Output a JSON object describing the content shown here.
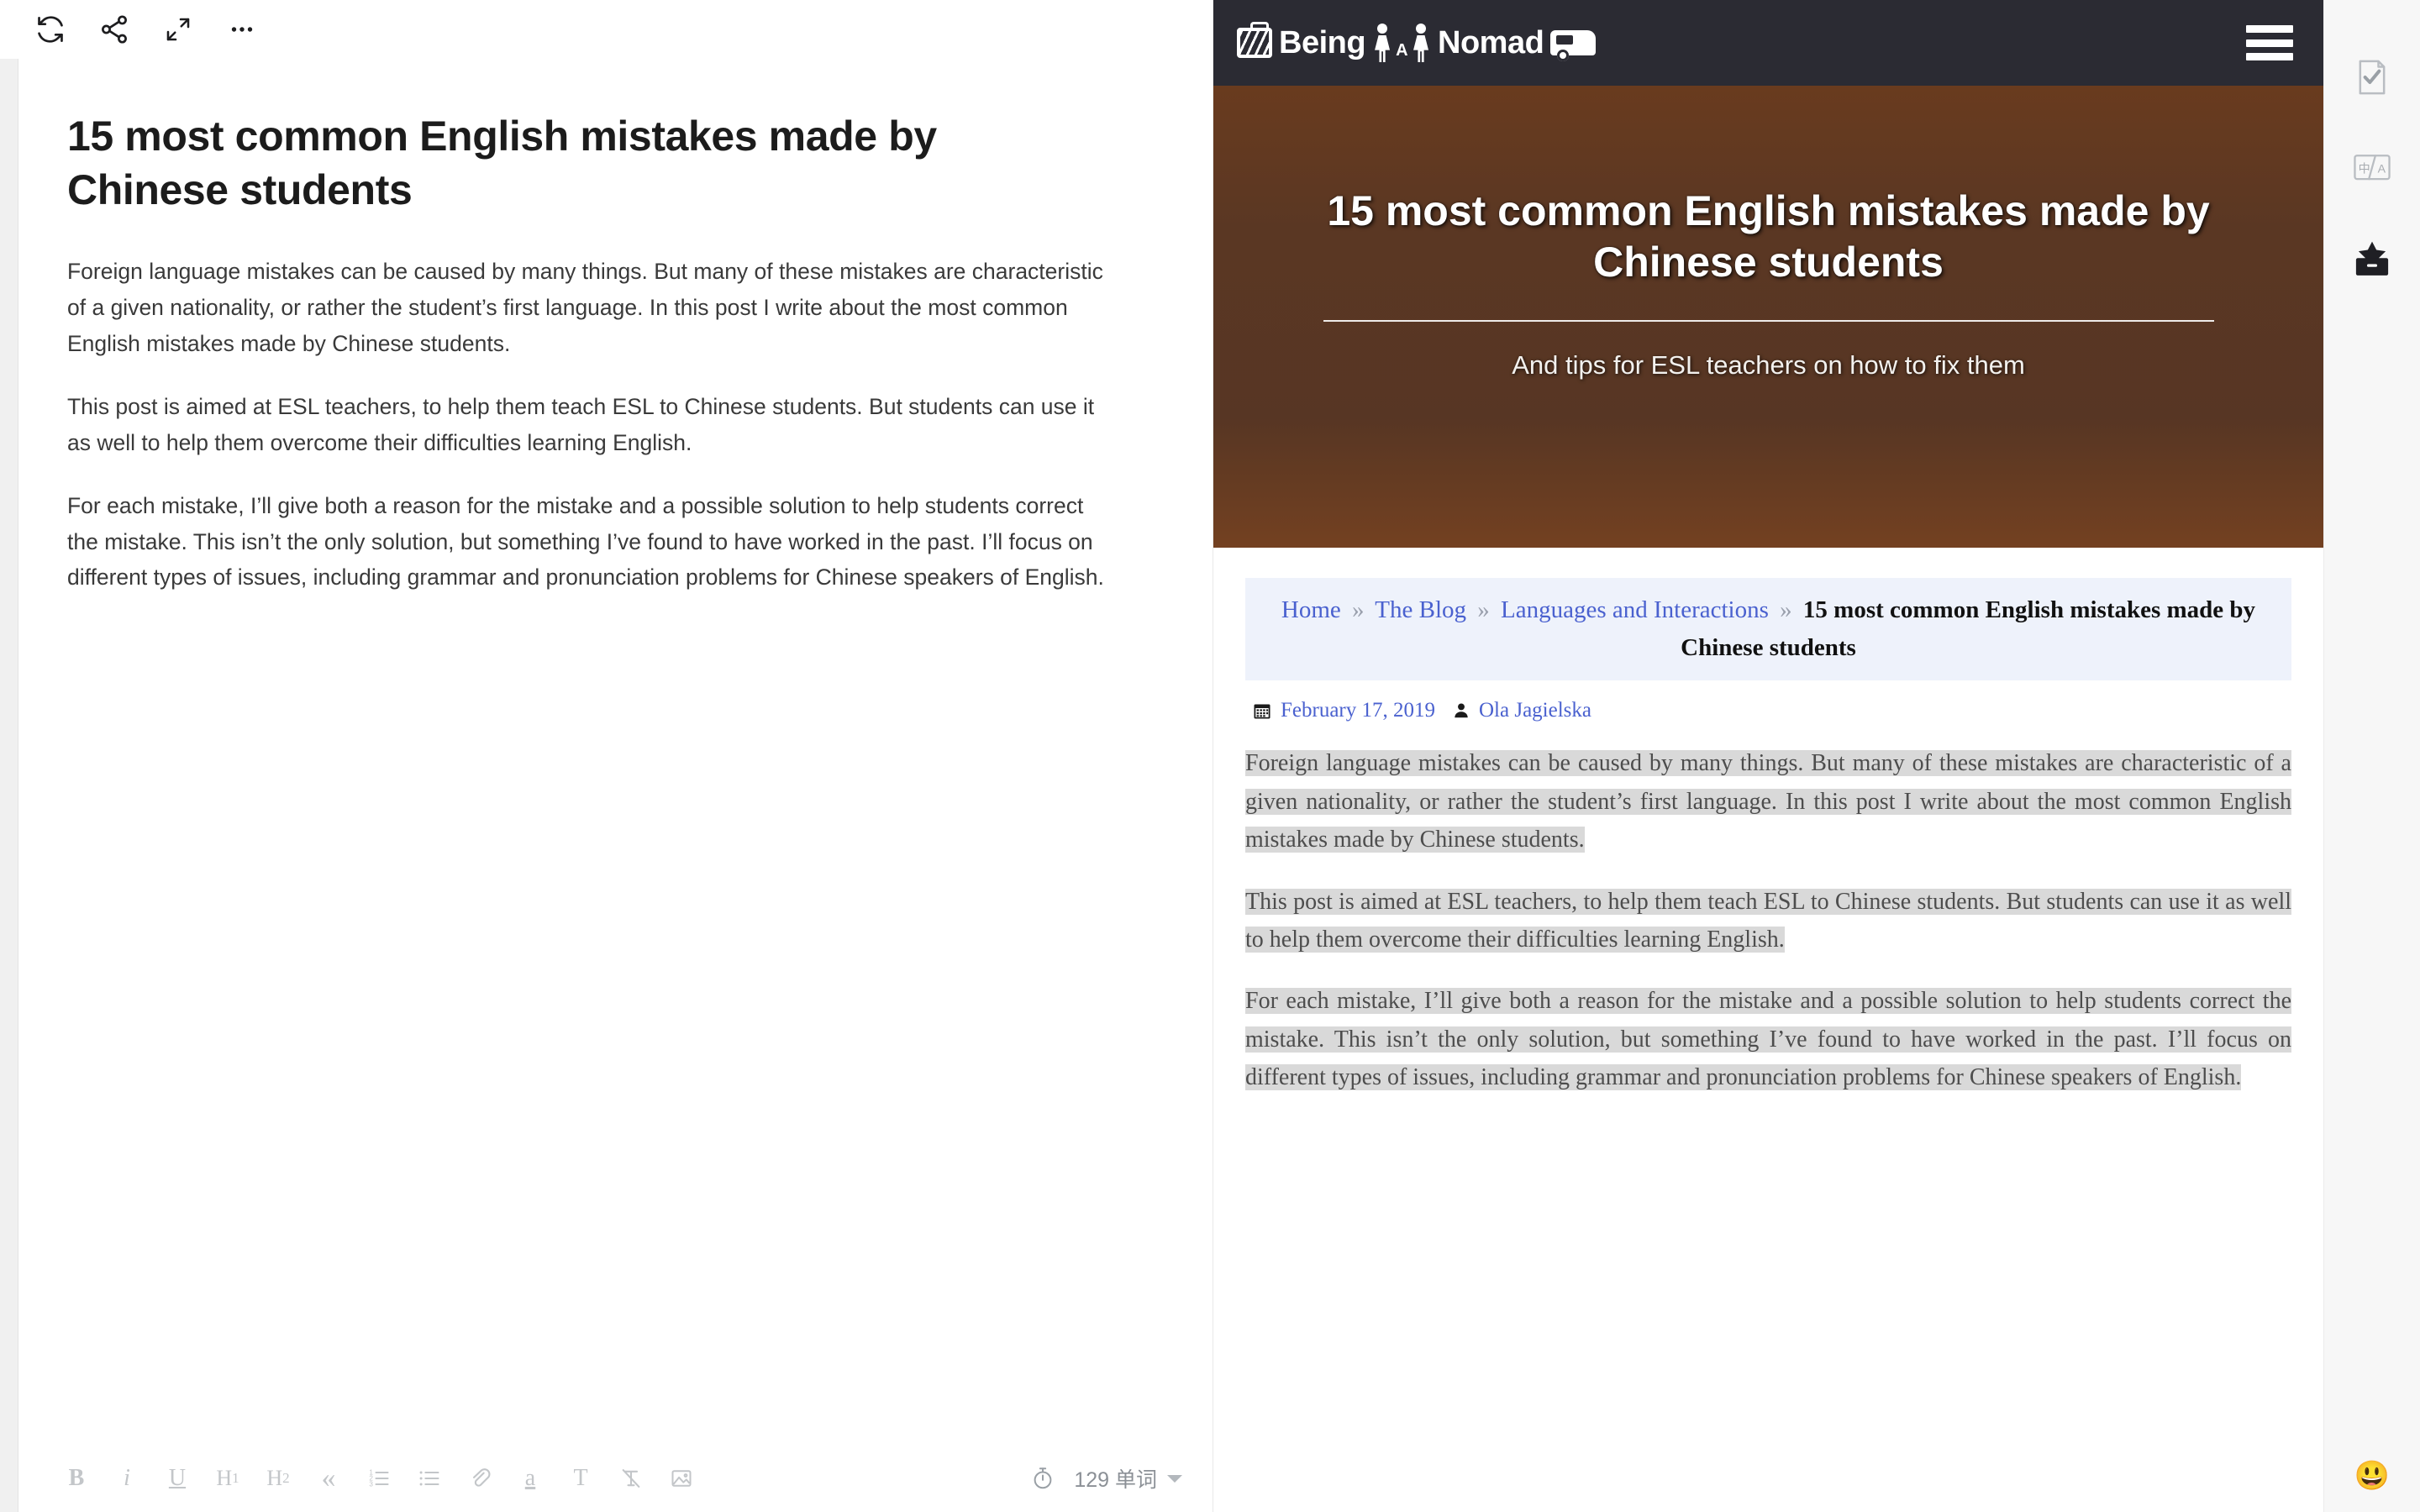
{
  "editor": {
    "toolbar_top": [
      {
        "name": "sync-icon",
        "label": "Sync"
      },
      {
        "name": "share-icon",
        "label": "Share"
      },
      {
        "name": "fullscreen-icon",
        "label": "Fullscreen"
      },
      {
        "name": "more-icon",
        "label": "More"
      }
    ],
    "document": {
      "title": "15 most common English mistakes made by Chinese students",
      "paragraphs": [
        "Foreign language mistakes can be caused by many things. But many of these mistakes are characteristic of a given nationality, or rather the student’s first language. In this post I write about the most common English mistakes made by Chinese students.",
        "This post is aimed at ESL teachers, to help them teach ESL to Chinese students. But students can use it as well to help them overcome their difficulties learning English.",
        "For each mistake, I’ll give both a reason for the mistake and a possible solution to help students correct the mistake. This isn’t the only solution, but something I’ve found to have worked in the past. I’ll focus on different types of issues, including grammar and pronunciation problems for Chinese speakers of English."
      ]
    },
    "format_toolbar": [
      {
        "name": "bold-button",
        "label": "B"
      },
      {
        "name": "italic-button",
        "label": "i"
      },
      {
        "name": "underline-button",
        "label": "U"
      },
      {
        "name": "heading1-button",
        "label": "H1"
      },
      {
        "name": "heading2-button",
        "label": "H2"
      },
      {
        "name": "blockquote-button",
        "label": "«"
      },
      {
        "name": "ordered-list-button",
        "label": "ordered-list-icon"
      },
      {
        "name": "unordered-list-button",
        "label": "unordered-list-icon"
      },
      {
        "name": "link-button",
        "label": "link-icon"
      },
      {
        "name": "text-color-button",
        "label": "a"
      },
      {
        "name": "font-button",
        "label": "T"
      },
      {
        "name": "clear-format-button",
        "label": "clear-format-icon"
      },
      {
        "name": "insert-image-button",
        "label": "image-icon"
      }
    ],
    "status": {
      "word_count": "129 单词",
      "timer_icon": "stopwatch-icon"
    }
  },
  "preview": {
    "site": {
      "logo_text_1": "Being",
      "logo_text_a": "A",
      "logo_text_2": "Nomad",
      "menu_label": "Menu"
    },
    "hero": {
      "title": "15 most common English mistakes made by Chinese students",
      "subtitle": "And tips for ESL teachers on how to fix them"
    },
    "breadcrumb": {
      "items": [
        {
          "label": "Home",
          "link": true
        },
        {
          "label": "The Blog",
          "link": true
        },
        {
          "label": "Languages and Interactions",
          "link": true
        }
      ],
      "separator": "»",
      "current": "15 most common English mistakes made by Chinese students"
    },
    "meta": {
      "date": "February 17, 2019",
      "author": "Ola Jagielska",
      "date_icon": "calendar-icon",
      "author_icon": "user-icon"
    },
    "post_paragraphs": [
      "Foreign language mistakes can be caused by many things. But many of these mistakes are characteristic of a given nationality, or rather the student’s first language. In this post I write about the most common English mistakes made by Chinese students.",
      "This post is aimed at ESL teachers, to help them teach ESL to Chinese students. But students can use it as well to help them overcome their difficulties learning English.",
      "For each mistake, I’ll give both a reason for the mistake and a possible solution to help students correct the mistake. This isn’t the only solution, but something I’ve found to have worked in the past. I’ll focus on different types of issues, including grammar and pronunciation problems for Chinese speakers of English."
    ]
  },
  "right_rail": {
    "items": [
      {
        "name": "proofread-icon",
        "label": "Proofread"
      },
      {
        "name": "translate-icon",
        "label": "Translate"
      },
      {
        "name": "archive-star-icon",
        "label": "Publish"
      }
    ],
    "emoji": "😃"
  },
  "colors": {
    "link": "#4a61cf",
    "navbar": "#2b2b33",
    "breadcrumb_bg": "#eef2fb",
    "highlight": "#d9d9d9",
    "rail_bg": "#f7f7f7"
  }
}
